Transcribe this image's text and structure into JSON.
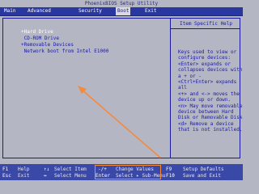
{
  "title": "PhoenixBIOS Setup Utility",
  "menu": [
    "Main",
    "Advanced",
    "Security",
    "Boot",
    "Exit"
  ],
  "active_menu": "Boot",
  "boot_order": [
    {
      "label": "+Hard Drive",
      "selected": true
    },
    {
      "label": " CD-ROM Drive",
      "selected": false
    },
    {
      "label": "+Removable Devices",
      "selected": false
    },
    {
      "label": " Network boot from Intel E1000",
      "selected": false
    }
  ],
  "help": {
    "title": "Item Specific Help",
    "text": "Keys used to view or\nconfigure devices:\n<Enter> expands or\ncollapses devices with\na + or -\n<Ctrl+Enter> expands\nall\n<+> and <-> moves the\ndevice up or down.\n<n> May move removable\ndevice between Hard\nDisk or Removable Disk\n<d> Remove a device\nthat is not installed."
  },
  "footer": {
    "row1": [
      {
        "key": "F1",
        "desc": "Help"
      },
      {
        "key": "↑↓",
        "desc": "Select Item"
      },
      {
        "key": "-/+",
        "desc": "Change Values"
      },
      {
        "key": "F9",
        "desc": "Setup Defaults"
      }
    ],
    "row2": [
      {
        "key": "Esc",
        "desc": "Exit"
      },
      {
        "key": "↔",
        "desc": "Select Menu"
      },
      {
        "key": "Enter",
        "desc": "Select ▸ Sub-Menu"
      },
      {
        "key": "F10",
        "desc": "Save and Exit"
      }
    ]
  },
  "colors": {
    "bios_blue": "#2838a0",
    "panel_gray": "#b4b6c4",
    "annotation_orange": "#f58a3c"
  }
}
